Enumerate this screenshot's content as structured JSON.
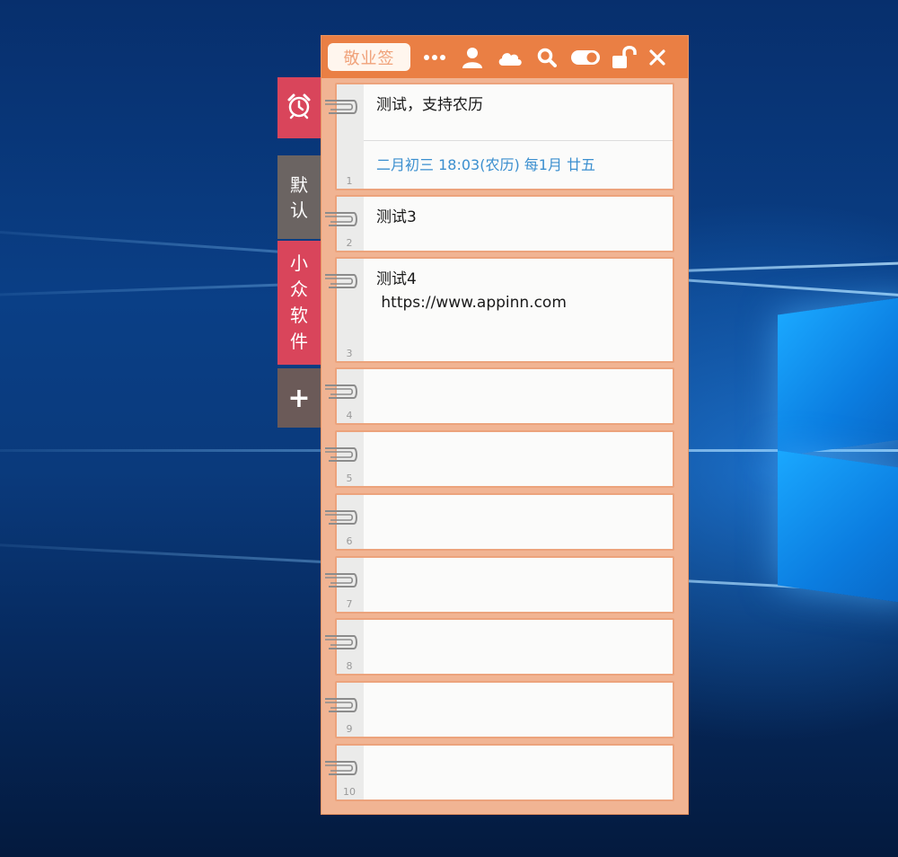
{
  "app": {
    "title": "敬业签",
    "accent_color": "#ea7f44",
    "toolbar_icons": [
      "more-icon",
      "user-icon",
      "cloud-icon",
      "search-icon",
      "toggle-icon",
      "unlock-icon",
      "close-icon"
    ]
  },
  "side_tabs": {
    "alarm_icon": "alarm-clock-icon",
    "default_label": [
      "默",
      "认"
    ],
    "appinn_label": [
      "小",
      "众",
      "软",
      "件"
    ],
    "add_label": "+"
  },
  "notes": [
    {
      "number": "1",
      "text": "测试，支持农历",
      "reminder": "二月初三 18:03(农历) 每1月 廿五"
    },
    {
      "number": "2",
      "text": "测试3"
    },
    {
      "number": "3",
      "text": "测试4\n https://www.appinn.com"
    },
    {
      "number": "4",
      "text": ""
    },
    {
      "number": "5",
      "text": ""
    },
    {
      "number": "6",
      "text": ""
    },
    {
      "number": "7",
      "text": ""
    },
    {
      "number": "8",
      "text": ""
    },
    {
      "number": "9",
      "text": ""
    },
    {
      "number": "10",
      "text": ""
    }
  ]
}
